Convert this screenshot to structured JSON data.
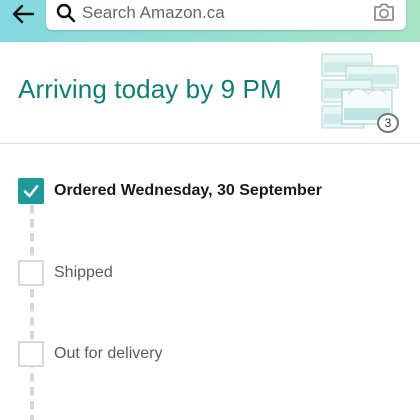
{
  "search": {
    "placeholder": "Search Amazon.ca"
  },
  "icons": {
    "back": "back-arrow-icon",
    "search": "search-icon",
    "camera": "camera-icon",
    "check": "checkmark-icon"
  },
  "colors": {
    "header_start": "#84d8e0",
    "header_end": "#a6e4c6",
    "title": "#0f7d74",
    "checked": "#1f9a9a",
    "unchecked_border": "#d5d9d9"
  },
  "shipment": {
    "title": "Arriving today by 9 PM",
    "quantity": "3"
  },
  "timeline": {
    "steps": [
      {
        "label": "Ordered Wednesday, 30 September",
        "checked": true
      },
      {
        "label": "Shipped",
        "checked": false
      },
      {
        "label": "Out for delivery",
        "checked": false
      }
    ]
  }
}
